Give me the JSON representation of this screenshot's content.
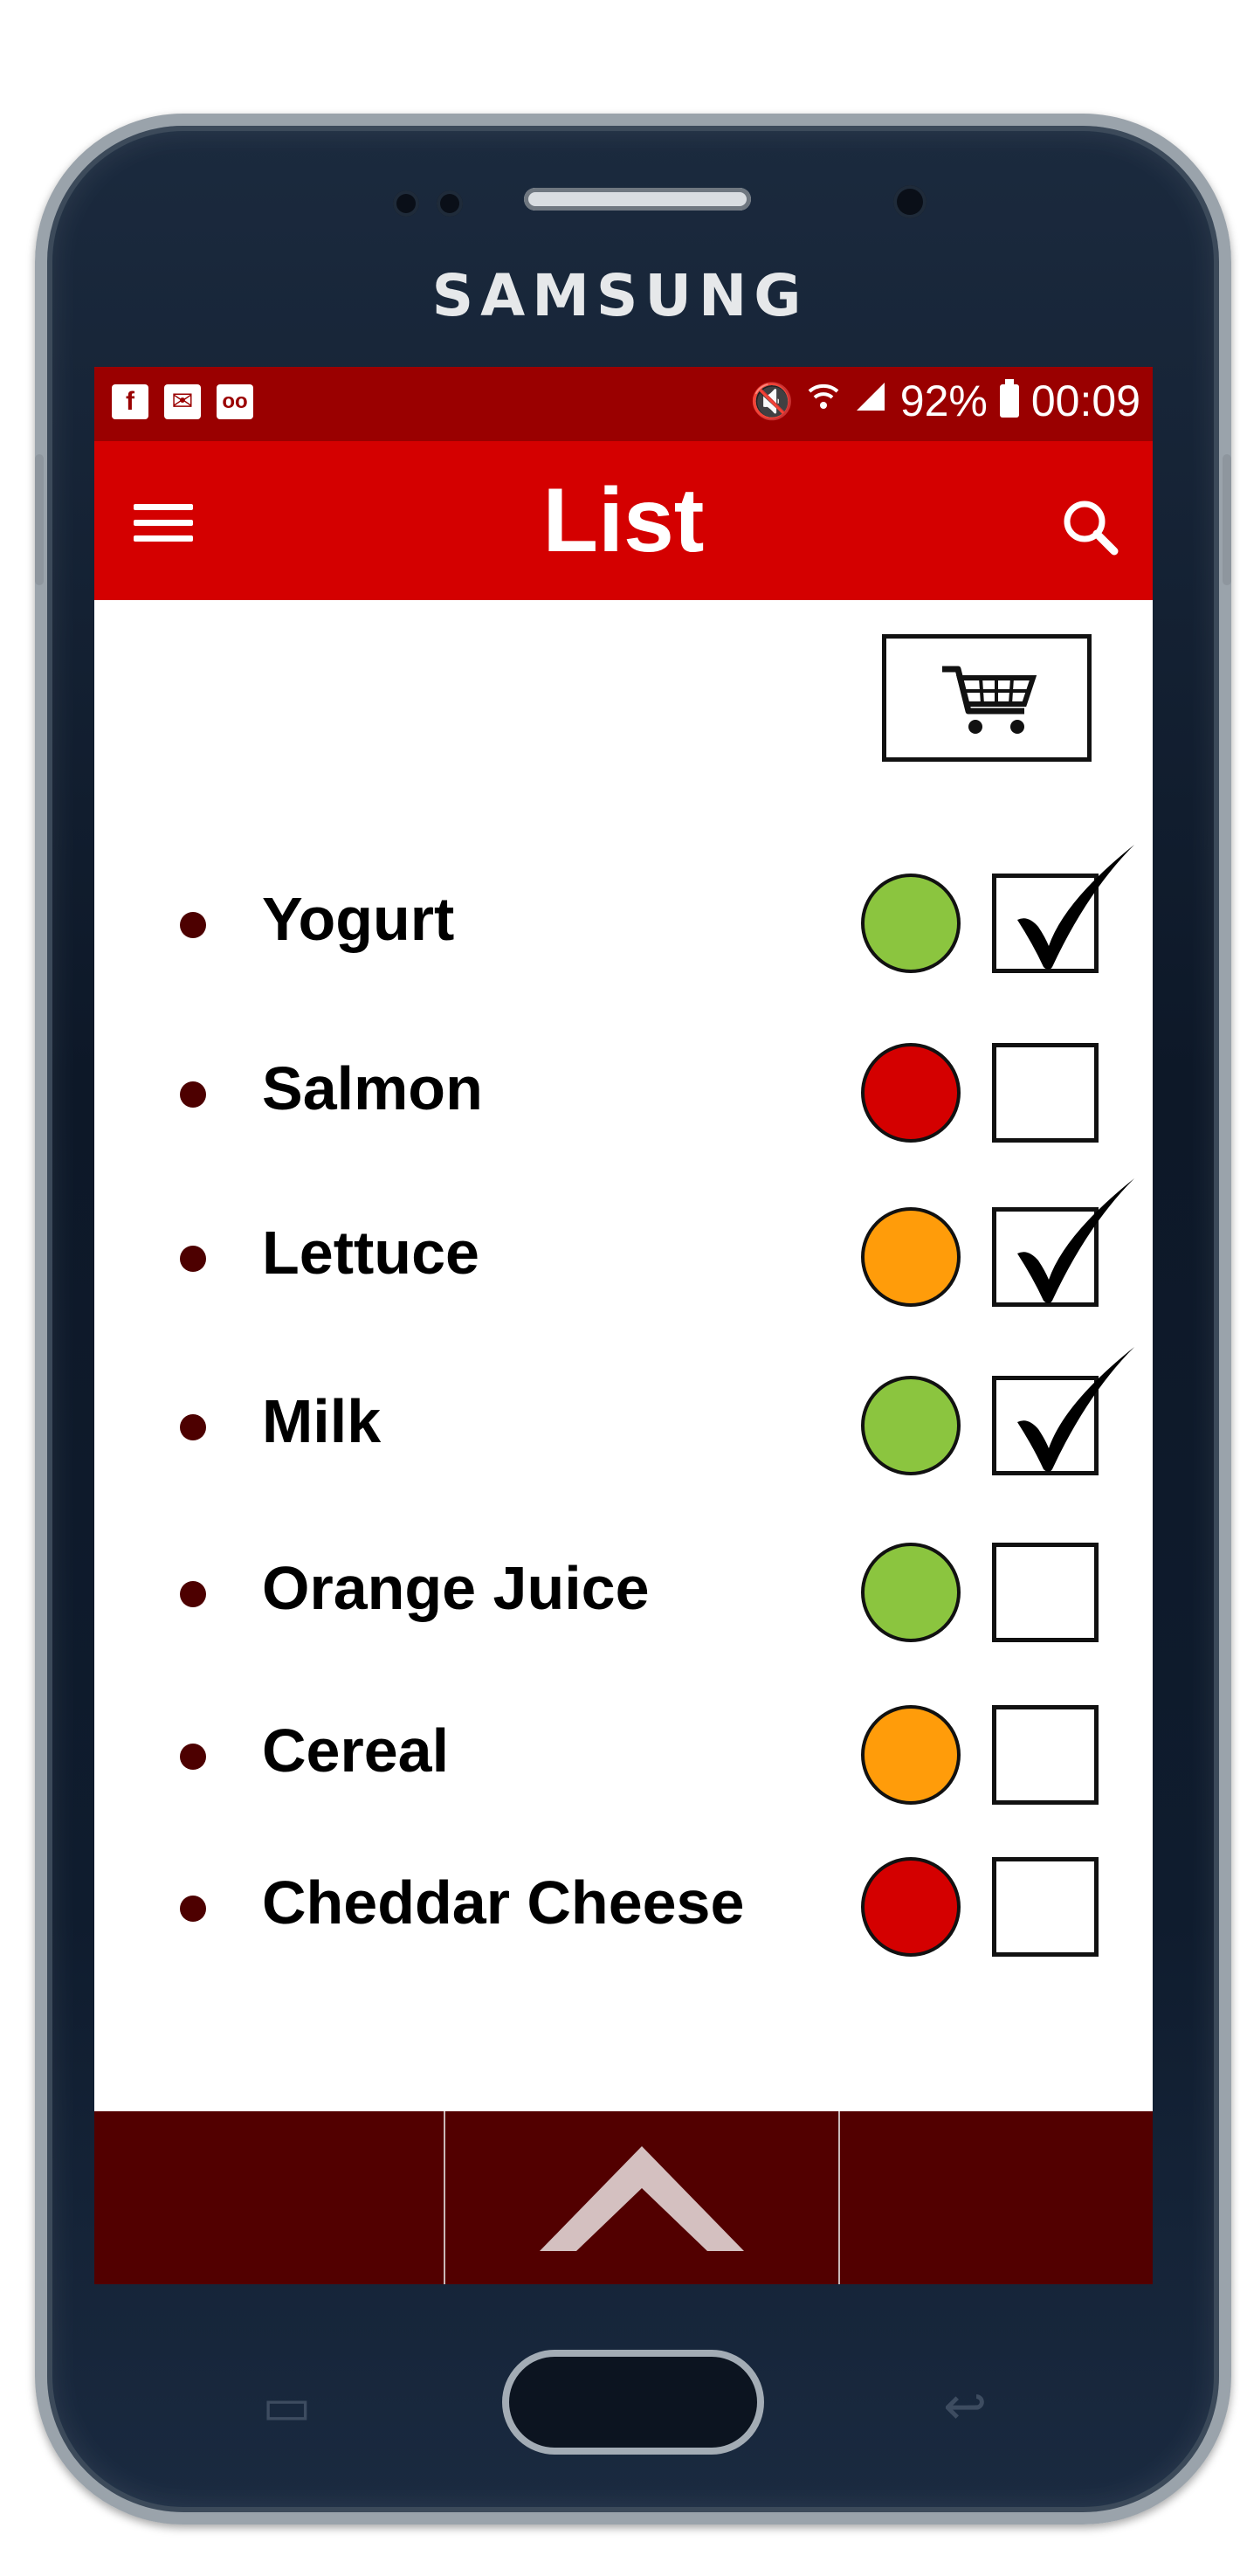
{
  "device": {
    "brand": "SAMSUNG"
  },
  "status_bar": {
    "left_icons": [
      "facebook-icon",
      "mail-icon",
      "voicemail-icon"
    ],
    "right_icons": [
      "mute-icon",
      "wifi-icon",
      "signal-icon"
    ],
    "battery": "92%",
    "time": "00:09"
  },
  "app_bar": {
    "title": "List",
    "menu_icon": "hamburger-icon",
    "search_icon": "search-icon"
  },
  "cart_button": {
    "icon": "shopping-cart-icon"
  },
  "colors": {
    "green": "#8bc53f",
    "red": "#d40000",
    "orange": "#ff9c0a",
    "app_bar": "#d40000",
    "status_bar": "#9a0000",
    "bottom_bar": "#520000"
  },
  "items": [
    {
      "label": "Yogurt",
      "status": "green",
      "checked": true
    },
    {
      "label": "Salmon",
      "status": "red",
      "checked": false
    },
    {
      "label": "Lettuce",
      "status": "orange",
      "checked": true
    },
    {
      "label": "Milk",
      "status": "green",
      "checked": true
    },
    {
      "label": "Orange Juice",
      "status": "green",
      "checked": false
    },
    {
      "label": "Cereal",
      "status": "orange",
      "checked": false
    },
    {
      "label": "Cheddar Cheese",
      "status": "red",
      "checked": false
    }
  ],
  "bottom_bar": {
    "center_icon": "chevron-up-icon"
  }
}
